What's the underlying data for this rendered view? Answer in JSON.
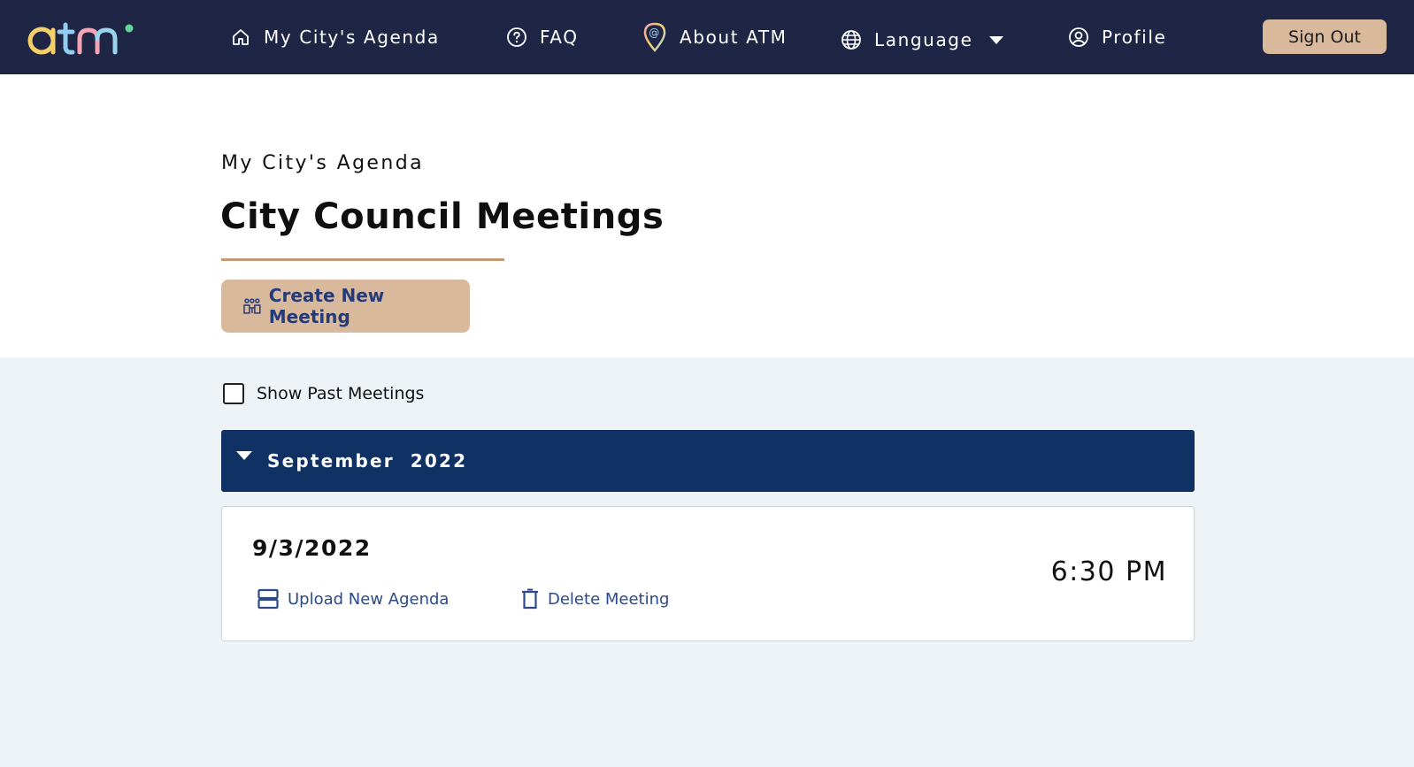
{
  "nav": {
    "logo_text": "atm",
    "items": [
      {
        "label": "My City's Agenda",
        "icon": "home-icon"
      },
      {
        "label": "FAQ",
        "icon": "question-circle-icon"
      },
      {
        "label": "About ATM",
        "icon": "location-at-pin-icon"
      },
      {
        "label": "Language",
        "icon": "globe-icon"
      },
      {
        "label": "Profile",
        "icon": "user-circle-icon"
      }
    ],
    "sign_out": "Sign Out"
  },
  "header": {
    "subtitle": "My City's Agenda",
    "title": "City Council Meetings",
    "create_button": "Create New Meeting"
  },
  "filters": {
    "show_past_label": "Show Past Meetings",
    "show_past_checked": false
  },
  "meetings": {
    "month": "September",
    "year": "2022",
    "items": [
      {
        "date": "9/3/2022",
        "time": "6:30 PM",
        "upload_label": "Upload New Agenda",
        "delete_label": "Delete Meeting"
      }
    ]
  },
  "colors": {
    "nav_bg": "#1f2545",
    "accent_tan": "#d9b99b",
    "month_bar": "#0f3163",
    "link_blue": "#2c4a86"
  }
}
